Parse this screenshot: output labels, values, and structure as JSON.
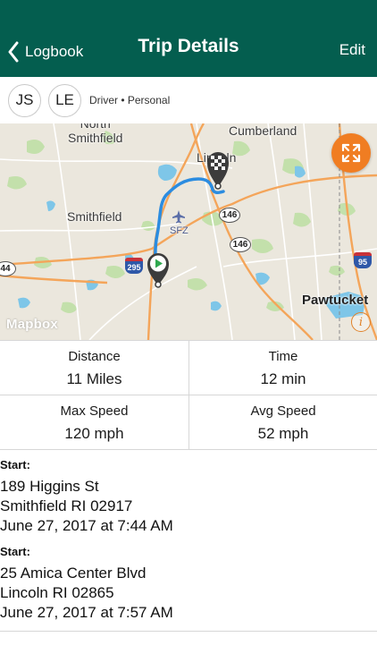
{
  "navbar": {
    "back_label": "Logbook",
    "title": "Trip Details",
    "edit_label": "Edit",
    "background": "#045e4f"
  },
  "participants": {
    "avatars": [
      "JS",
      "LE"
    ],
    "role_label": "Driver • Personal"
  },
  "map": {
    "places": {
      "north_smithfield": "North\nSmithfield",
      "smithfield": "Smithfield",
      "cumberland": "Cumberland",
      "lincoln": "Lincoln",
      "pawtucket": "Pawtucket",
      "airport": "SFZ"
    },
    "route_shields": {
      "r146_a": "146",
      "r146_b": "146",
      "i295": "295",
      "i95": "95",
      "r44": "44"
    },
    "attribution": "Mapbox",
    "info_glyph": "i",
    "expand_icon": "expand-arrows-icon",
    "start_marker_icon": "play-icon",
    "end_marker_icon": "checkered-flag-icon",
    "route_color": "#2b8ce0",
    "accent": "#f07d22"
  },
  "stats": {
    "distance": {
      "label": "Distance",
      "value": "11 Miles"
    },
    "time": {
      "label": "Time",
      "value": "12 min"
    },
    "max_speed": {
      "label": "Max Speed",
      "value": "120 mph"
    },
    "avg_speed": {
      "label": "Avg Speed",
      "value": "52 mph"
    }
  },
  "start": {
    "heading": "Start:",
    "street": "189 Higgins St",
    "city": "Smithfield RI 02917",
    "datetime": "June 27, 2017 at 7:44 AM"
  },
  "end": {
    "heading": "Start:",
    "street": "25 Amica Center Blvd",
    "city": "Lincoln RI 02865",
    "datetime": "June 27, 2017 at 7:57 AM"
  }
}
